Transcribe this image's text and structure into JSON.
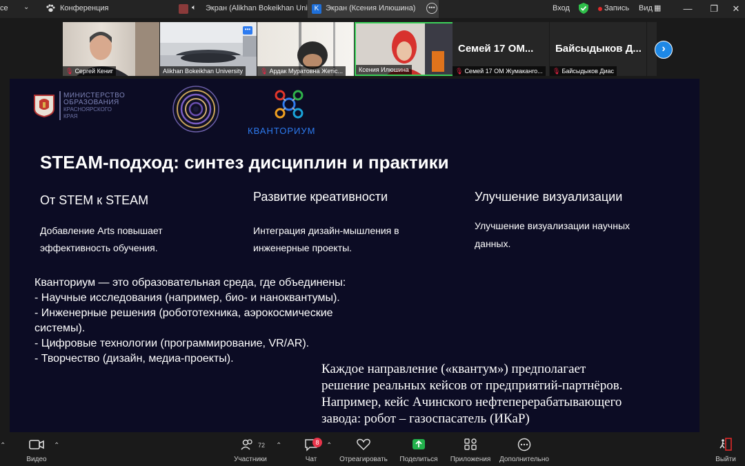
{
  "titlebar": {
    "left_fragment": "ce",
    "meeting_label": "Конференция",
    "tab1_label": "Экран (Alikhan Bokeikhan Univer",
    "tab2_label": "Экран (Ксения Илюшина)",
    "tab2_icon_letter": "K",
    "signin_label": "Вход",
    "record_label": "Запись",
    "view_label": "Вид"
  },
  "gallery": {
    "participants": [
      {
        "name": "Сергей Кениг",
        "muted": true
      },
      {
        "name": "Alikhan Bokeikhan University",
        "muted": false
      },
      {
        "name": "Ардак Муратовна Жетіс...",
        "muted": true
      },
      {
        "name": "Ксения Илюшина",
        "muted": false
      },
      {
        "name": "Семей 17 ОМ Жумаканго...",
        "muted": true,
        "big_name": "Семей 17 ОМ..."
      },
      {
        "name": "Байсыдыков Диас",
        "muted": true,
        "big_name": "Байсыдыков Д..."
      }
    ]
  },
  "slide": {
    "logo_ministry": [
      "МИНИСТЕРСТВО",
      "ОБРАЗОВАНИЯ",
      "КРАСНОЯРСКОГО",
      "КРАЯ"
    ],
    "logo_kvantorium": "КВАНТОРИУМ",
    "title": "STEAM-подход: синтез дисциплин и практики",
    "col1_heading": "От STEM к STEAM",
    "col1_text_1": "Добавление Arts повышает",
    "col1_text_2": "эффективность обучения.",
    "col2_heading": "Развитие креативности",
    "col2_text_1": "Интеграция дизайн-мышления в",
    "col2_text_2": "инженерные проекты.",
    "col3_heading": "Улучшение визуализации",
    "col3_text_1": "Улучшение визуализации научных",
    "col3_text_2": "данных.",
    "list_lines": [
      "Кванториум — это образовательная среда, где объединены:",
      "- Научные исследования (например, био- и наноквантумы).",
      "- Инженерные решения (робототехника, аэрокосмические",
      "системы).",
      "- Цифровые технологии (программирование, VR/AR).",
      "- Творчество (дизайн, медиа-проекты)."
    ],
    "serif_lines": [
      "Каждое направление («квантум») предполагает",
      "решение реальных кейсов от предприятий-партнёров.",
      "Например, кейс Ачинского нефтеперерабатывающего",
      "завода: робот – газоспасатель (ИКаР)"
    ]
  },
  "toolbar": {
    "video_label": "Видео",
    "participants_label": "Участники",
    "participants_count": "72",
    "chat_label": "Чат",
    "chat_badge": "8",
    "react_label": "Отреагировать",
    "share_label": "Поделиться",
    "apps_label": "Приложения",
    "more_label": "Дополнительно",
    "leave_label": "Выйти"
  },
  "colors": {
    "slide_bg": "#0c0c24",
    "active_tile_border": "#3cd15a",
    "share_green": "#22b14c",
    "record_red": "#e02a2a",
    "badge_red": "#e8344a",
    "arrow_blue": "#1e88e5"
  }
}
